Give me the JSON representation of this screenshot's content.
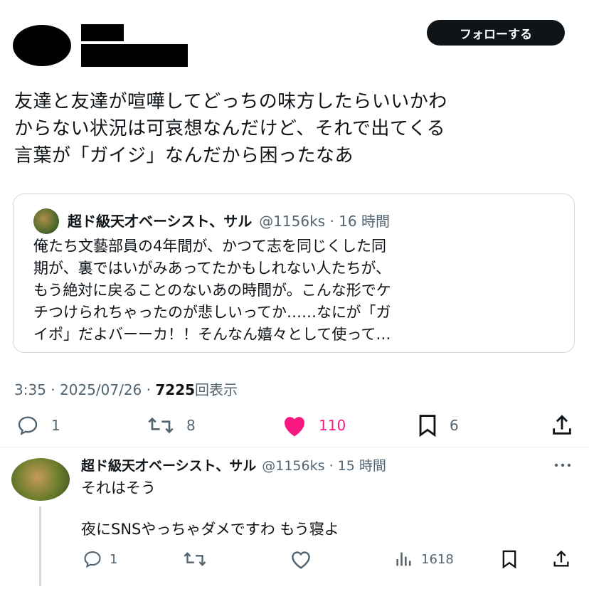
{
  "header": {
    "follow_label": "フォローする"
  },
  "tweet": {
    "lines": [
      "友達と友達が喧嘩してどっちの味方したらいいかわ",
      "からない状況は可哀想なんだけど、それで出てくる",
      "言葉が「ガイジ」なんだから困ったなあ"
    ],
    "time": "3:35",
    "date": "2025/07/26",
    "views": "7225",
    "views_label": "回表示",
    "sep": "·"
  },
  "quote": {
    "name": "超ド級天才ベーシスト、サル",
    "handle": "@1156ks",
    "time": "16 時間",
    "lines": [
      "俺たち文藝部員の4年間が、かつて志を同じくした同",
      "期が、裏ではいがみあってたかもしれない人たちが、",
      "もう絶対に戻ることのないあの時間が。こんな形でケ",
      "チつけられちゃったのが悲しいってか……なにが「ガ",
      "イポ」だよバーーカ！！そんなん嬉々として使って…"
    ]
  },
  "actions": {
    "reply_count": "1",
    "retweet_count": "8",
    "like_count": "110",
    "bookmark_count": "6",
    "like_color": "#f91880"
  },
  "reply": {
    "name": "超ド級天才ベーシスト、サル",
    "handle": "@1156ks",
    "time": "15 時間",
    "sep": "·",
    "line1": "それはそう",
    "line2": "夜にSNSやっちゃダメですわ もう寝よ",
    "reply_count": "1",
    "views_count": "1618"
  }
}
